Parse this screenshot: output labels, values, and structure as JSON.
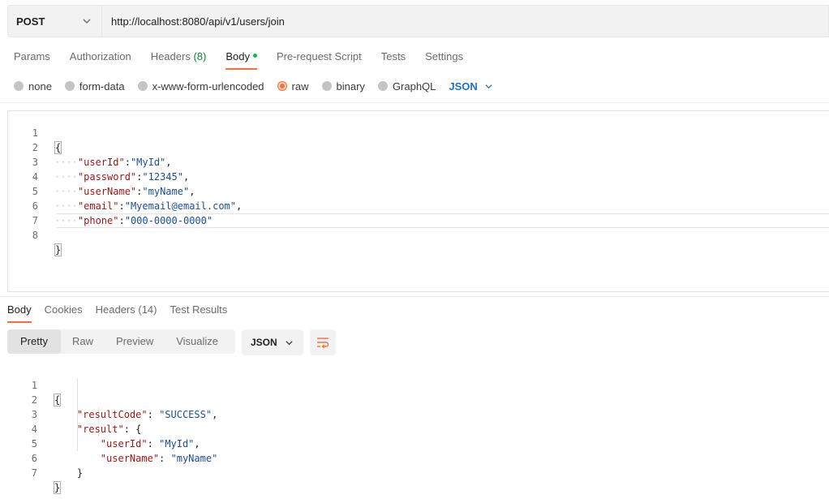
{
  "request": {
    "method": "POST",
    "url": "http://localhost:8080/api/v1/users/join"
  },
  "request_tabs": [
    {
      "label": "Params"
    },
    {
      "label": "Authorization"
    },
    {
      "label": "Headers",
      "count": "(8)"
    },
    {
      "label": "Body"
    },
    {
      "label": "Pre-request Script"
    },
    {
      "label": "Tests"
    },
    {
      "label": "Settings"
    }
  ],
  "active_request_tab": "Body",
  "body_types": [
    "none",
    "form-data",
    "x-www-form-urlencoded",
    "raw",
    "binary",
    "GraphQL"
  ],
  "selected_body_type": "raw",
  "body_language": "JSON",
  "request_body": {
    "line_numbers": [
      "1",
      "2",
      "3",
      "4",
      "5",
      "6",
      "7",
      "8"
    ],
    "lines": {
      "open": "{",
      "userId_key": "\"userId\"",
      "userId_val": "\"MyId\"",
      "password_key": "\"password\"",
      "password_val": "\"12345\"",
      "userName_key": "\"userName\"",
      "userName_val": "\"myName\"",
      "email_key": "\"email\"",
      "email_val": "\"Myemail@email.com\"",
      "phone_key": "\"phone\"",
      "phone_val": "\"000-0000-0000\"",
      "close": "}"
    }
  },
  "response_tabs": [
    {
      "label": "Body"
    },
    {
      "label": "Cookies"
    },
    {
      "label": "Headers (14)"
    },
    {
      "label": "Test Results"
    }
  ],
  "active_response_tab": "Body",
  "view_modes": [
    "Pretty",
    "Raw",
    "Preview",
    "Visualize"
  ],
  "active_view_mode": "Pretty",
  "response_format": "JSON",
  "response_body": {
    "line_numbers": [
      "1",
      "2",
      "3",
      "4",
      "5",
      "6",
      "7"
    ],
    "lines": {
      "open": "{",
      "resultCode_key": "\"resultCode\"",
      "resultCode_val": "\"SUCCESS\"",
      "result_key": "\"result\"",
      "inner_open": "{",
      "userId_key": "\"userId\"",
      "userId_val": "\"MyId\"",
      "userName_key": "\"userName\"",
      "userName_val": "\"myName\"",
      "inner_close": "}",
      "close": "}"
    }
  },
  "colors": {
    "accent": "#ff6c37",
    "active_dot": "#0cbb52",
    "json_key": "#a31515",
    "json_string": "#1a4c9c",
    "lang_link": "#1a73c9"
  }
}
